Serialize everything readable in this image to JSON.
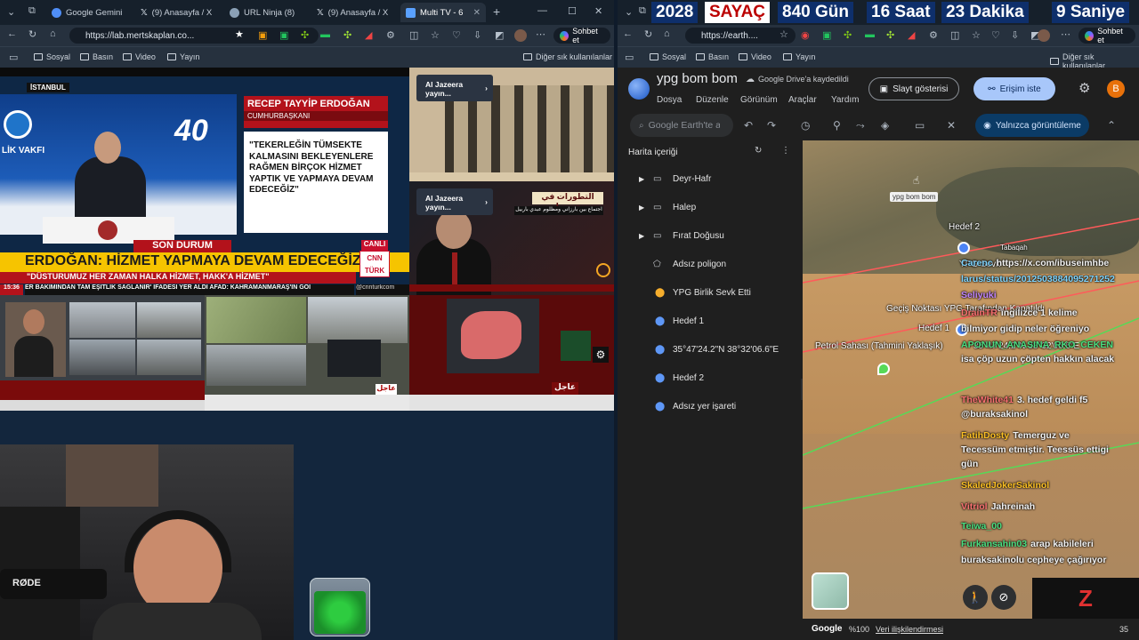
{
  "left_browser": {
    "tabs": [
      {
        "label": "Google Gemini",
        "icon": "gemini-icon",
        "color": "#4f8ef7"
      },
      {
        "label": "(9) Anasayfa / X",
        "icon": "x-icon",
        "color": "#ffffff"
      },
      {
        "label": "URL Ninja (8)",
        "icon": "globe-icon",
        "color": "#8aa0b6"
      },
      {
        "label": "(9) Anasayfa / X",
        "icon": "x-icon",
        "color": "#ffffff"
      },
      {
        "label": "Multi TV - 6",
        "icon": "tv-icon",
        "color": "#5aa1ff"
      }
    ],
    "url": "https://lab.mertskaplan.co...",
    "chat_label": "Sohbet et",
    "bookmarks": [
      "Sosyal",
      "Basın",
      "Video",
      "Yayın"
    ],
    "other_bookmarks": "Diğer sık kullanılanlar"
  },
  "right_browser": {
    "url": "https://earth....",
    "chat_label": "Sohbet et",
    "bookmarks": [
      "Sosyal",
      "Basın",
      "Video",
      "Yayın"
    ],
    "other_bookmarks": "Diğer sık kullanılanlar"
  },
  "countdown": {
    "year": "2028",
    "label": "SAYAÇ",
    "days": "840 Gün",
    "hours": "16 Saat",
    "minutes": "23 Dakika",
    "seconds": "9 Saniye"
  },
  "tv": {
    "location_tag": "İSTANBUL",
    "speaker_name": "RECEP TAYYİP ERDOĞAN",
    "speaker_title": "CUMHURBAŞKANI",
    "quote": "\"TEKERLEĞİN TÜMSEKTE KALMASINI BEKLEYENLERE RAĞMEN BİRÇOK HİZMET YAPTIK VE YAPMAYA DEVAM EDECEĞİZ\"",
    "foundation": "LİK VAKFI",
    "anniversary": "40",
    "breaking": "SON DURUM",
    "live": "CANLI",
    "headline": "ERDOĞAN: HİZMET YAPMAYA DEVAM EDECEĞİZ",
    "subheadline": "\"DÜSTURUMUZ HER ZAMAN HALKA HİZMET, HAKK'A HİZMET\"",
    "channel": "CNN TÜRK",
    "ticker_time": "15:36",
    "ticker": "ER BAKIMINDAN TAM EŞİTLİK SAĞLANIR' İFADESİ YER ALDI   AFAD: KAHRAMANMARAŞ'IN GÖI",
    "ticker_handle": "@cnnturkcom",
    "aj_label_1": "Al Jazeera yayın...",
    "aj_label_2": "Al Jazeera yayın...",
    "arabic_banner": "التطورات في سوريا",
    "arabic_sub": "اجتماع بين بارزاني ومظلوم عبدي بأربيل",
    "breaking_ar": "عاجل",
    "rode": "RØDE"
  },
  "earth": {
    "title": "ypg bom bom",
    "saved": "Google Drive'a kaydedildi",
    "menu": [
      "Dosya",
      "Düzenle",
      "Görünüm",
      "Araçlar",
      "Yardım"
    ],
    "slideshow": "Slayt gösterisi",
    "access": "Erişim iste",
    "avatar": "B",
    "search_placeholder": "Google Earth'te ara",
    "view_only": "Yalnızca görüntüleme",
    "panel_title": "Harita içeriği",
    "items": [
      {
        "label": "Deyr-Hafr",
        "type": "folder"
      },
      {
        "label": "Halep",
        "type": "folder"
      },
      {
        "label": "Fırat Doğusu",
        "type": "folder"
      },
      {
        "label": "Adsız poligon",
        "type": "polygon"
      },
      {
        "label": "YPG Birlik Sevk Etti",
        "type": "pin-orange"
      },
      {
        "label": "Hedef 1",
        "type": "pin-blue"
      },
      {
        "label": "35°47'24.2\"N 38°32'06.6\"E",
        "type": "pin-blue"
      },
      {
        "label": "Hedef 2",
        "type": "pin-blue"
      },
      {
        "label": "Adsız yer işareti",
        "type": "pin-blue"
      }
    ],
    "tooltip": "ypg bom bom",
    "map_labels": {
      "hedef2": "Hedef 2",
      "tabaqah": "Tabaqah",
      "ypg_sevk": "YPG Sevk",
      "gecis": "Geçiş Noktası YPG Tarafından Kapatıldı",
      "hedef1": "Hedef 1",
      "petrol": "Petrol Sahası (Tahmini Yaklaşık)",
      "coord": "35°47'24.2\"N 38°32'06.6\"E"
    },
    "footer_google": "Google",
    "footer_zoom": "%100",
    "footer_link": "Veri ilişkilendirmesi",
    "footer_num": "35"
  },
  "chat_messages": [
    {
      "user": "Carenc",
      "text": "https://x.com/ibuseimhbe",
      "color": "#7dd3fc"
    },
    {
      "user": "",
      "text": "larus/status/2012503884095271252",
      "color": "#7dd3fc"
    },
    {
      "user": "Seliyuki",
      "text": "",
      "color": "#c084fc"
    },
    {
      "user": "DrainTR",
      "text": "ingilizce 1 kelime",
      "color": "#f87171"
    },
    {
      "user": "",
      "text": "bilmiyor gidip neler öğreniyo",
      "color": "#f2f2f2"
    },
    {
      "user": "APONUN_ANASINA_RKO_CEKEN",
      "text": "",
      "color": "#4ade80"
    },
    {
      "user": "",
      "text": "isa çöp uzun çöpten hakkın alacak",
      "color": "#f2f2f2"
    },
    {
      "user": "TheWhite41",
      "text": "3. hedef geldi f5",
      "color": "#f87171"
    },
    {
      "user": "",
      "text": "@buraksakinol",
      "color": "#f2f2f2"
    },
    {
      "user": "FatihDosty",
      "text": "Temerguz ve",
      "color": "#fbbf24"
    },
    {
      "user": "",
      "text": "Tecessüm etmiştir. Teessüs ettigi",
      "color": "#f2f2f2"
    },
    {
      "user": "",
      "text": "gün",
      "color": "#f2f2f2"
    },
    {
      "user": "SkaledJokerSakinol",
      "text": "",
      "color": "#fbbf24"
    },
    {
      "user": "Vitriol",
      "text": "Jahreinah",
      "color": "#f87171"
    },
    {
      "user": "Teiwa_00",
      "text": "",
      "color": "#4ade80"
    },
    {
      "user": "Furkansahin03",
      "text": "arap kabileleri",
      "color": "#4ade80"
    },
    {
      "user": "",
      "text": "buraksakinolu cepheye çağırıyor",
      "color": "#f2f2f2"
    }
  ],
  "colors": {
    "accent": "#8ab4f8",
    "cnn_red": "#c8102e",
    "aj_red": "#8b0b0b",
    "earth_bg": "#1f1f1f"
  }
}
